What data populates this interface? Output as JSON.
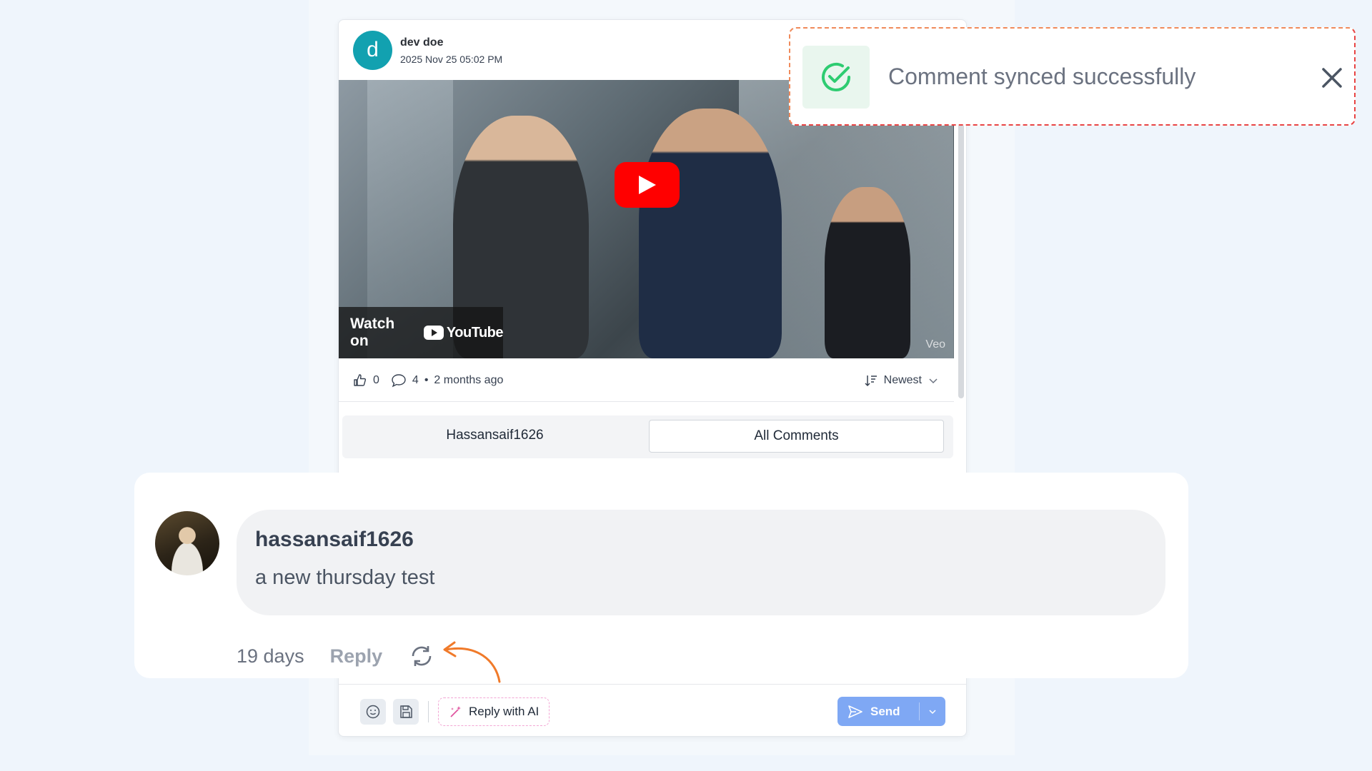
{
  "post": {
    "author_initial": "d",
    "author": "dev doe",
    "date": "2025 Nov 25 05:02 PM",
    "video": {
      "watch_on": "Watch on",
      "youtube_label": "YouTube",
      "watermark": "Veo"
    },
    "likes": "0",
    "comments": "4",
    "separator": "•",
    "age": "2 months ago",
    "sort_label": "Newest"
  },
  "tabs": [
    {
      "label": "Hassansaif1626",
      "active": false
    },
    {
      "label": "All Comments",
      "active": true
    }
  ],
  "comment": {
    "username": "hassansaif1626",
    "text": "a new thursday test",
    "age": "19 days",
    "reply_label": "Reply"
  },
  "composer": {
    "ai_label": "Reply with AI",
    "send_label": "Send"
  },
  "toast": {
    "message": "Comment synced successfully"
  },
  "colors": {
    "accent": "#7fa8f4",
    "success": "#2ecc71",
    "avatar_bg": "#12a1b0",
    "arrow": "#f07a2a"
  }
}
